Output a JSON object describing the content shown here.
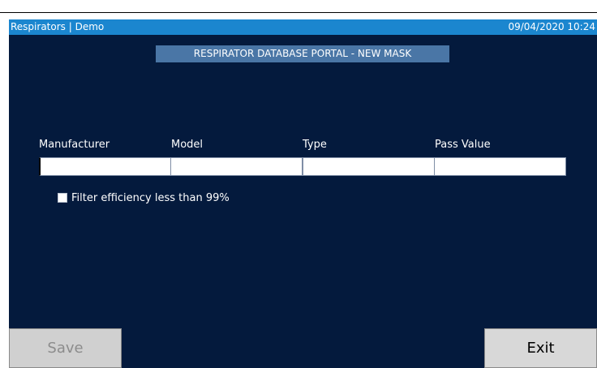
{
  "window": {
    "title": "Respirators | Demo",
    "datetime": "09/04/2020 10:24"
  },
  "header": {
    "title": "RESPIRATOR DATABASE PORTAL - NEW MASK"
  },
  "form": {
    "columns": [
      {
        "label": "Manufacturer",
        "value": ""
      },
      {
        "label": "Model",
        "value": ""
      },
      {
        "label": "Type",
        "value": ""
      },
      {
        "label": "Pass Value",
        "value": ""
      }
    ],
    "filter_checkbox": {
      "label": "Filter efficiency less than 99%",
      "checked": false
    }
  },
  "buttons": {
    "save": {
      "label": "Save",
      "enabled": false
    },
    "exit": {
      "label": "Exit",
      "enabled": true
    }
  },
  "colors": {
    "background": "#041a3d",
    "titlebar": "#1b86cf",
    "header": "#4a76a6"
  }
}
